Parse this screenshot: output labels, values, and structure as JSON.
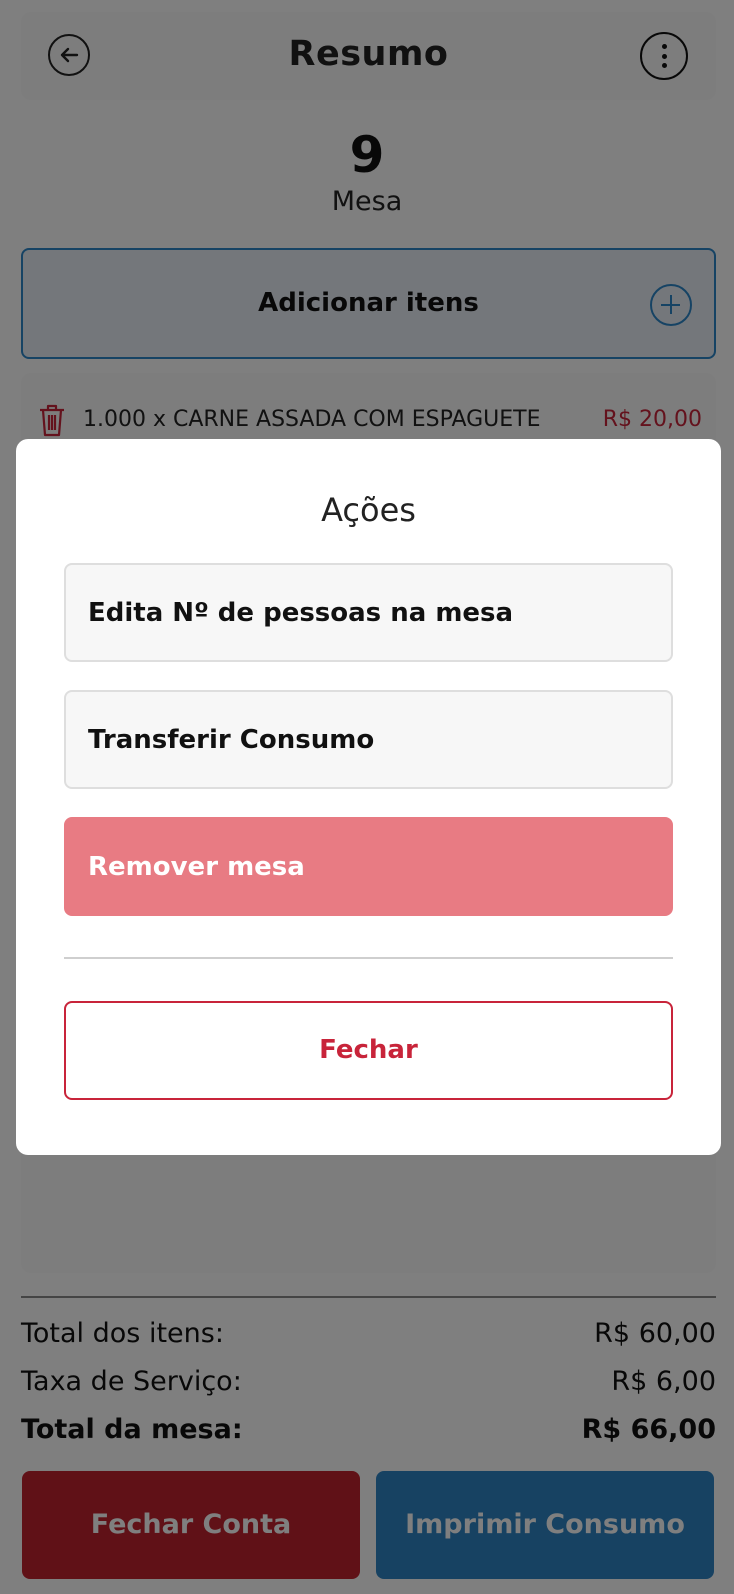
{
  "header": {
    "title": "Resumo",
    "back_icon": "arrow-left-circle-icon",
    "more_icon": "more-vertical-icon"
  },
  "table": {
    "number": "9",
    "label": "Mesa"
  },
  "add_items": {
    "label": "Adicionar itens",
    "icon": "plus-circle-icon"
  },
  "order_items": [
    {
      "description": "1.000 x CARNE ASSADA COM ESPAGUETE",
      "price": "R$ 20,00",
      "icon": "trash-icon"
    }
  ],
  "summary": {
    "items_total_label": "Total dos itens:",
    "items_total_value": "R$ 60,00",
    "service_fee_label": "Taxa de Serviço:",
    "service_fee_value": "R$ 6,00",
    "table_total_label": "Total da mesa:",
    "table_total_value": "R$ 66,00"
  },
  "footer": {
    "close_bill_label": "Fechar Conta",
    "print_label": "Imprimir Consumo"
  },
  "modal": {
    "title": "Ações",
    "actions": [
      {
        "label": "Edita Nº de pessoas na mesa"
      },
      {
        "label": "Transferir Consumo"
      },
      {
        "label": "Remover mesa"
      }
    ],
    "close_label": "Fechar"
  },
  "colors": {
    "accent_blue": "#2c86c9",
    "danger_red": "#c8243a",
    "remove_pink": "#e87b83"
  }
}
